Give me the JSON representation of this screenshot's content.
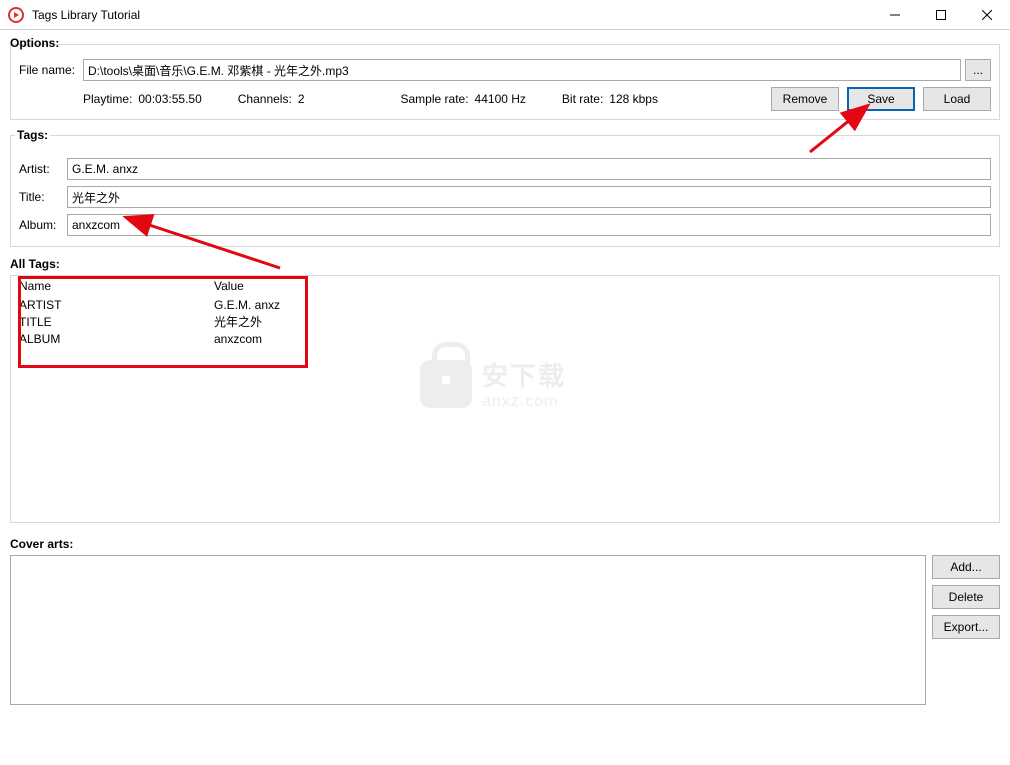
{
  "window": {
    "title": "Tags Library Tutorial"
  },
  "options": {
    "section_label": "Options:",
    "file_label": "File name:",
    "file_value": "D:\\tools\\桌面\\音乐\\G.E.M. 邓紫棋 - 光年之外.mp3",
    "browse_label": "...",
    "playtime_label": "Playtime:",
    "playtime_value": "00:03:55.50",
    "channels_label": "Channels:",
    "channels_value": "2",
    "samplerate_label": "Sample rate:",
    "samplerate_value": "44100 Hz",
    "bitrate_label": "Bit rate:",
    "bitrate_value": "128 kbps",
    "remove_label": "Remove",
    "save_label": "Save",
    "load_label": "Load"
  },
  "tags": {
    "section_label": "Tags:",
    "artist_label": "Artist:",
    "artist_value": "G.E.M. anxz",
    "title_label": "Title:",
    "title_value": "光年之外",
    "album_label": "Album:",
    "album_value": "anxzcom"
  },
  "all_tags": {
    "section_label": "All Tags:",
    "headers": {
      "name": "Name",
      "value": "Value"
    },
    "rows": [
      {
        "name": "ARTIST",
        "value": "G.E.M. anxz"
      },
      {
        "name": "TITLE",
        "value": "光年之外"
      },
      {
        "name": "ALBUM",
        "value": "anxzcom"
      }
    ]
  },
  "cover": {
    "section_label": "Cover arts:",
    "add_label": "Add...",
    "delete_label": "Delete",
    "export_label": "Export..."
  },
  "watermark": {
    "text1": "安下载",
    "text2": "anxz.com"
  }
}
